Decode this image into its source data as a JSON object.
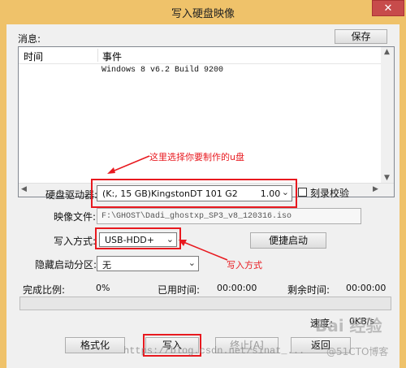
{
  "window": {
    "title": "写入硬盘映像",
    "close_glyph": "✕"
  },
  "messages": {
    "label": "消息:",
    "save_button": "保存"
  },
  "log": {
    "columns": [
      "时间",
      "事件"
    ],
    "rows": [
      {
        "time": "",
        "event": "Windows 8 v6.2 Build 9200"
      }
    ]
  },
  "drive": {
    "label": "硬盘驱动器:",
    "value": "(K:, 15 GB)KingstonDT 101 G2        1.00",
    "verify_label": "刻录校验",
    "verify_checked": false
  },
  "image": {
    "label": "映像文件:",
    "value": "F:\\GHOST\\Dadi_ghostxp_SP3_v8_120316.iso"
  },
  "write_mode": {
    "label": "写入方式:",
    "value": "USB-HDD+",
    "quick_boot_button": "便捷启动"
  },
  "hidden_partition": {
    "label": "隐藏启动分区:",
    "value": "无"
  },
  "progress": {
    "ratio_label": "完成比例:",
    "ratio_value": "0%",
    "elapsed_label": "已用时间:",
    "elapsed_value": "00:00:00",
    "remaining_label": "剩余时间:",
    "remaining_value": "00:00:00",
    "fraction": 0,
    "speed_label": "速度:",
    "speed_value": "0KB/s"
  },
  "buttons": {
    "format": "格式化",
    "write": "写入",
    "stop": "终止[A]",
    "back": "返回"
  },
  "annotations": {
    "drive_note": "这里选择你要制作的u盘",
    "mode_note": "写入方式"
  },
  "watermarks": {
    "url": "https://blog.csdn.net/sinat_...",
    "brand": "Bai 经验",
    "site": "@51CTO博客"
  },
  "colors": {
    "title_bar": "#efc26a",
    "annotation": "#e8191f",
    "close_button": "#c74b4b"
  }
}
